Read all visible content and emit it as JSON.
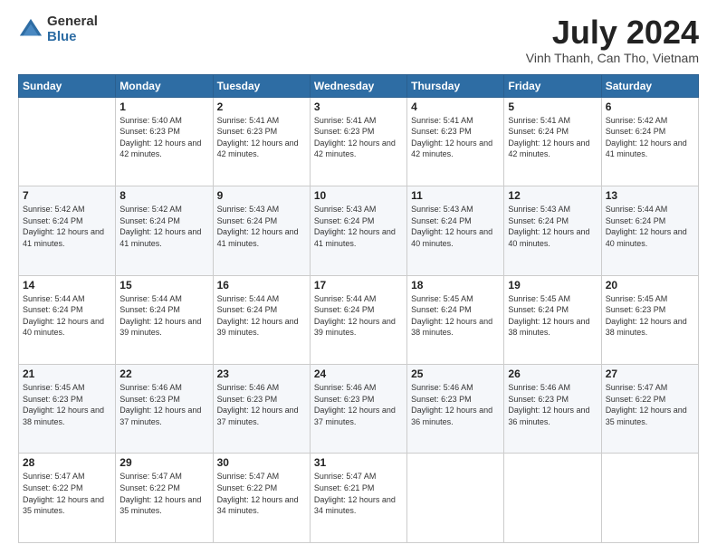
{
  "logo": {
    "general": "General",
    "blue": "Blue"
  },
  "title": {
    "month_year": "July 2024",
    "location": "Vinh Thanh, Can Tho, Vietnam"
  },
  "days_of_week": [
    "Sunday",
    "Monday",
    "Tuesday",
    "Wednesday",
    "Thursday",
    "Friday",
    "Saturday"
  ],
  "weeks": [
    [
      {
        "day": "",
        "sunrise": "",
        "sunset": "",
        "daylight": ""
      },
      {
        "day": "1",
        "sunrise": "Sunrise: 5:40 AM",
        "sunset": "Sunset: 6:23 PM",
        "daylight": "Daylight: 12 hours and 42 minutes."
      },
      {
        "day": "2",
        "sunrise": "Sunrise: 5:41 AM",
        "sunset": "Sunset: 6:23 PM",
        "daylight": "Daylight: 12 hours and 42 minutes."
      },
      {
        "day": "3",
        "sunrise": "Sunrise: 5:41 AM",
        "sunset": "Sunset: 6:23 PM",
        "daylight": "Daylight: 12 hours and 42 minutes."
      },
      {
        "day": "4",
        "sunrise": "Sunrise: 5:41 AM",
        "sunset": "Sunset: 6:23 PM",
        "daylight": "Daylight: 12 hours and 42 minutes."
      },
      {
        "day": "5",
        "sunrise": "Sunrise: 5:41 AM",
        "sunset": "Sunset: 6:24 PM",
        "daylight": "Daylight: 12 hours and 42 minutes."
      },
      {
        "day": "6",
        "sunrise": "Sunrise: 5:42 AM",
        "sunset": "Sunset: 6:24 PM",
        "daylight": "Daylight: 12 hours and 41 minutes."
      }
    ],
    [
      {
        "day": "7",
        "sunrise": "Sunrise: 5:42 AM",
        "sunset": "Sunset: 6:24 PM",
        "daylight": "Daylight: 12 hours and 41 minutes."
      },
      {
        "day": "8",
        "sunrise": "Sunrise: 5:42 AM",
        "sunset": "Sunset: 6:24 PM",
        "daylight": "Daylight: 12 hours and 41 minutes."
      },
      {
        "day": "9",
        "sunrise": "Sunrise: 5:43 AM",
        "sunset": "Sunset: 6:24 PM",
        "daylight": "Daylight: 12 hours and 41 minutes."
      },
      {
        "day": "10",
        "sunrise": "Sunrise: 5:43 AM",
        "sunset": "Sunset: 6:24 PM",
        "daylight": "Daylight: 12 hours and 41 minutes."
      },
      {
        "day": "11",
        "sunrise": "Sunrise: 5:43 AM",
        "sunset": "Sunset: 6:24 PM",
        "daylight": "Daylight: 12 hours and 40 minutes."
      },
      {
        "day": "12",
        "sunrise": "Sunrise: 5:43 AM",
        "sunset": "Sunset: 6:24 PM",
        "daylight": "Daylight: 12 hours and 40 minutes."
      },
      {
        "day": "13",
        "sunrise": "Sunrise: 5:44 AM",
        "sunset": "Sunset: 6:24 PM",
        "daylight": "Daylight: 12 hours and 40 minutes."
      }
    ],
    [
      {
        "day": "14",
        "sunrise": "Sunrise: 5:44 AM",
        "sunset": "Sunset: 6:24 PM",
        "daylight": "Daylight: 12 hours and 40 minutes."
      },
      {
        "day": "15",
        "sunrise": "Sunrise: 5:44 AM",
        "sunset": "Sunset: 6:24 PM",
        "daylight": "Daylight: 12 hours and 39 minutes."
      },
      {
        "day": "16",
        "sunrise": "Sunrise: 5:44 AM",
        "sunset": "Sunset: 6:24 PM",
        "daylight": "Daylight: 12 hours and 39 minutes."
      },
      {
        "day": "17",
        "sunrise": "Sunrise: 5:44 AM",
        "sunset": "Sunset: 6:24 PM",
        "daylight": "Daylight: 12 hours and 39 minutes."
      },
      {
        "day": "18",
        "sunrise": "Sunrise: 5:45 AM",
        "sunset": "Sunset: 6:24 PM",
        "daylight": "Daylight: 12 hours and 38 minutes."
      },
      {
        "day": "19",
        "sunrise": "Sunrise: 5:45 AM",
        "sunset": "Sunset: 6:24 PM",
        "daylight": "Daylight: 12 hours and 38 minutes."
      },
      {
        "day": "20",
        "sunrise": "Sunrise: 5:45 AM",
        "sunset": "Sunset: 6:23 PM",
        "daylight": "Daylight: 12 hours and 38 minutes."
      }
    ],
    [
      {
        "day": "21",
        "sunrise": "Sunrise: 5:45 AM",
        "sunset": "Sunset: 6:23 PM",
        "daylight": "Daylight: 12 hours and 38 minutes."
      },
      {
        "day": "22",
        "sunrise": "Sunrise: 5:46 AM",
        "sunset": "Sunset: 6:23 PM",
        "daylight": "Daylight: 12 hours and 37 minutes."
      },
      {
        "day": "23",
        "sunrise": "Sunrise: 5:46 AM",
        "sunset": "Sunset: 6:23 PM",
        "daylight": "Daylight: 12 hours and 37 minutes."
      },
      {
        "day": "24",
        "sunrise": "Sunrise: 5:46 AM",
        "sunset": "Sunset: 6:23 PM",
        "daylight": "Daylight: 12 hours and 37 minutes."
      },
      {
        "day": "25",
        "sunrise": "Sunrise: 5:46 AM",
        "sunset": "Sunset: 6:23 PM",
        "daylight": "Daylight: 12 hours and 36 minutes."
      },
      {
        "day": "26",
        "sunrise": "Sunrise: 5:46 AM",
        "sunset": "Sunset: 6:23 PM",
        "daylight": "Daylight: 12 hours and 36 minutes."
      },
      {
        "day": "27",
        "sunrise": "Sunrise: 5:47 AM",
        "sunset": "Sunset: 6:22 PM",
        "daylight": "Daylight: 12 hours and 35 minutes."
      }
    ],
    [
      {
        "day": "28",
        "sunrise": "Sunrise: 5:47 AM",
        "sunset": "Sunset: 6:22 PM",
        "daylight": "Daylight: 12 hours and 35 minutes."
      },
      {
        "day": "29",
        "sunrise": "Sunrise: 5:47 AM",
        "sunset": "Sunset: 6:22 PM",
        "daylight": "Daylight: 12 hours and 35 minutes."
      },
      {
        "day": "30",
        "sunrise": "Sunrise: 5:47 AM",
        "sunset": "Sunset: 6:22 PM",
        "daylight": "Daylight: 12 hours and 34 minutes."
      },
      {
        "day": "31",
        "sunrise": "Sunrise: 5:47 AM",
        "sunset": "Sunset: 6:21 PM",
        "daylight": "Daylight: 12 hours and 34 minutes."
      },
      {
        "day": "",
        "sunrise": "",
        "sunset": "",
        "daylight": ""
      },
      {
        "day": "",
        "sunrise": "",
        "sunset": "",
        "daylight": ""
      },
      {
        "day": "",
        "sunrise": "",
        "sunset": "",
        "daylight": ""
      }
    ]
  ]
}
